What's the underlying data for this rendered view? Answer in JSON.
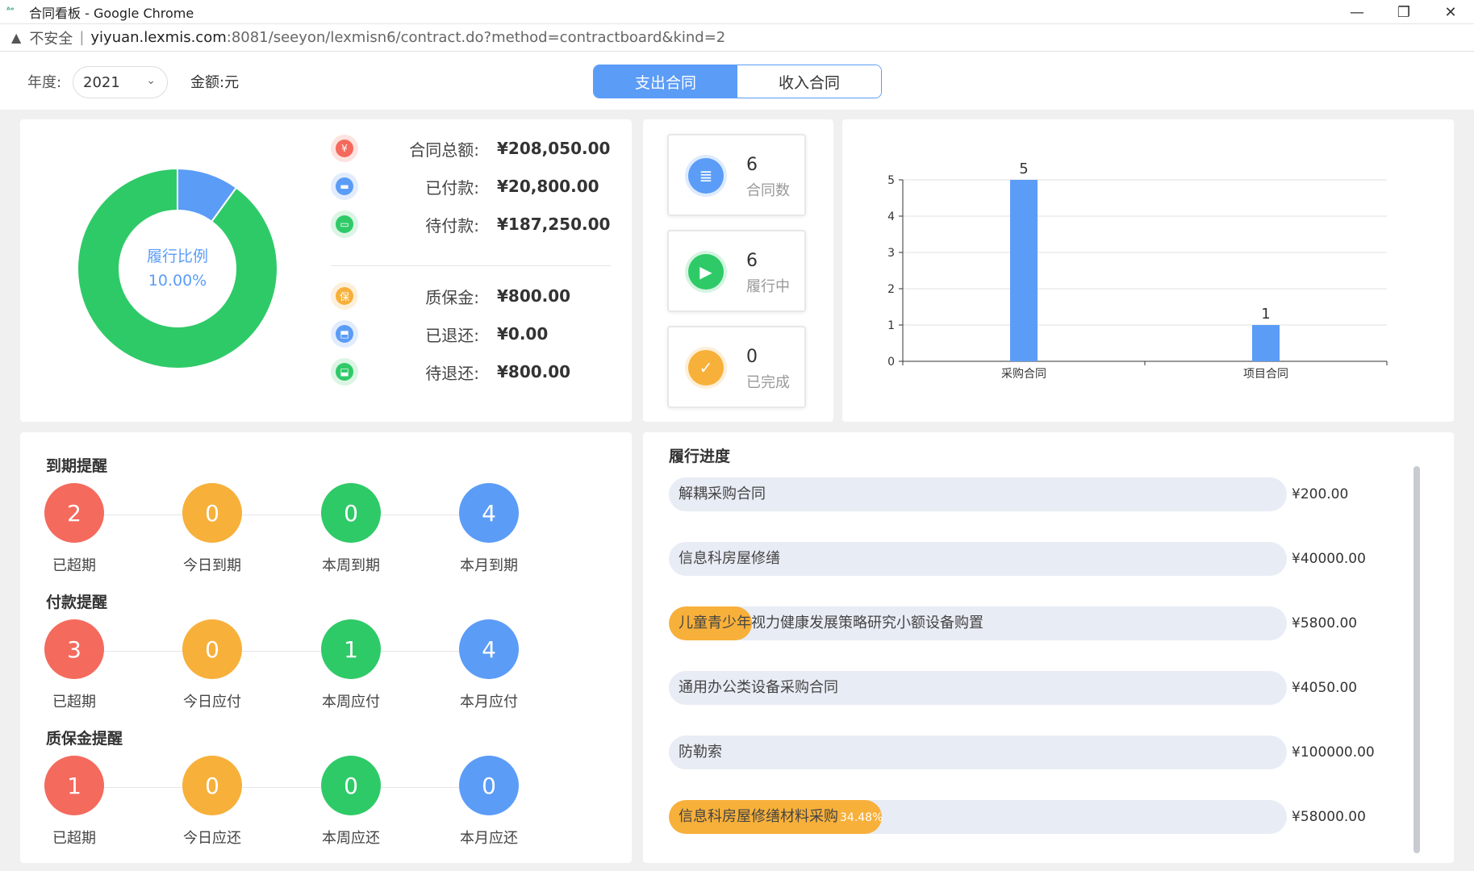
{
  "browser": {
    "window_title": "合同看板 - Google Chrome",
    "insecure_label": "不安全",
    "url_host": "yiyuan.lexmis.com",
    "url_rest": ":8081/seeyon/lexmisn6/contract.do?method=contractboard&kind=2"
  },
  "filters": {
    "year_label": "年度:",
    "year_value": "2021",
    "amount_unit_label": "金额:元",
    "tabs": [
      {
        "label": "支出合同",
        "active": true
      },
      {
        "label": "收入合同",
        "active": false
      }
    ]
  },
  "summary": {
    "donut_title": "履行比例",
    "donut_percent_text": "10.00%",
    "donut_fraction": 0.1,
    "rows": [
      {
        "icon": "yen-icon",
        "color": "#f46a5d",
        "bg": "#fde3e0",
        "label": "合同总额:",
        "value": "¥208,050.00"
      },
      {
        "icon": "wallet-icon",
        "color": "#5b9cf7",
        "bg": "#e2ecfd",
        "label": "已付款:",
        "value": "¥20,800.00"
      },
      {
        "icon": "card-icon",
        "color": "#2fca68",
        "bg": "#dbf5e4",
        "label": "待付款:",
        "value": "¥187,250.00"
      },
      {
        "icon": "shield-icon",
        "color": "#f7b03a",
        "bg": "#fdf0da",
        "label": "质保金:",
        "value": "¥800.00"
      },
      {
        "icon": "return-icon",
        "color": "#5b9cf7",
        "bg": "#e2ecfd",
        "label": "已退还:",
        "value": "¥0.00"
      },
      {
        "icon": "pending-return-icon",
        "color": "#2fca68",
        "bg": "#dbf5e4",
        "label": "待退还:",
        "value": "¥800.00"
      }
    ]
  },
  "stats": [
    {
      "icon": "contract-icon",
      "color": "#5b9cf7",
      "number": "6",
      "label": "合同数"
    },
    {
      "icon": "play-cycle-icon",
      "color": "#2fca68",
      "number": "6",
      "label": "履行中"
    },
    {
      "icon": "check-icon",
      "color": "#f7b03a",
      "number": "0",
      "label": "已完成"
    }
  ],
  "chart_data": {
    "type": "bar",
    "categories": [
      "采购合同",
      "项目合同"
    ],
    "values": [
      5,
      1
    ],
    "ylim": [
      0,
      5
    ],
    "yticks": [
      "0",
      "1",
      "2",
      "3",
      "4",
      "5"
    ],
    "data_labels": [
      "5",
      "1"
    ],
    "bar_color": "#5b9cf7",
    "grid": true
  },
  "reminders": [
    {
      "title": "到期提醒",
      "items": [
        {
          "count": "2",
          "label": "已超期",
          "color": "#f46a5d"
        },
        {
          "count": "0",
          "label": "今日到期",
          "color": "#f7b03a"
        },
        {
          "count": "0",
          "label": "本周到期",
          "color": "#2fca68"
        },
        {
          "count": "4",
          "label": "本月到期",
          "color": "#5b9cf7"
        }
      ]
    },
    {
      "title": "付款提醒",
      "items": [
        {
          "count": "3",
          "label": "已超期",
          "color": "#f46a5d"
        },
        {
          "count": "0",
          "label": "今日应付",
          "color": "#f7b03a"
        },
        {
          "count": "1",
          "label": "本周应付",
          "color": "#2fca68"
        },
        {
          "count": "4",
          "label": "本月应付",
          "color": "#5b9cf7"
        }
      ]
    },
    {
      "title": "质保金提醒",
      "items": [
        {
          "count": "1",
          "label": "已超期",
          "color": "#f46a5d"
        },
        {
          "count": "0",
          "label": "今日应还",
          "color": "#f7b03a"
        },
        {
          "count": "0",
          "label": "本周应还",
          "color": "#2fca68"
        },
        {
          "count": "0",
          "label": "本月应还",
          "color": "#5b9cf7"
        }
      ]
    }
  ],
  "progress": {
    "title": "履行进度",
    "items": [
      {
        "name": "解耦采购合同",
        "amount": "¥200.00",
        "fraction": 0,
        "pct_text": ""
      },
      {
        "name": "信息科房屋修缮",
        "amount": "¥40000.00",
        "fraction": 0,
        "pct_text": ""
      },
      {
        "name": "儿童青少年视力健康发展策略研究小额设备购置",
        "amount": "¥5800.00",
        "fraction": 0.135,
        "pct_text": ""
      },
      {
        "name": "通用办公类设备采购合同",
        "amount": "¥4050.00",
        "fraction": 0,
        "pct_text": ""
      },
      {
        "name": "防勒索",
        "amount": "¥100000.00",
        "fraction": 0,
        "pct_text": ""
      },
      {
        "name": "信息科房屋修缮材料采购",
        "amount": "¥58000.00",
        "fraction": 0.3448,
        "pct_text": "34.48%"
      }
    ]
  }
}
